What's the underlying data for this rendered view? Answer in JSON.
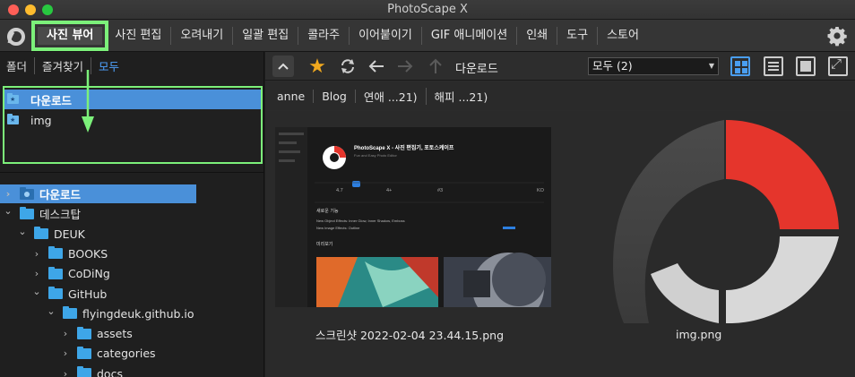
{
  "window": {
    "title": "PhotoScape X"
  },
  "menu": {
    "items": [
      "사진 뷰어",
      "사진 편집",
      "오려내기",
      "일괄 편집",
      "콜라주",
      "이어붙이기",
      "GIF 애니메이션",
      "인쇄",
      "도구",
      "스토어"
    ],
    "active": "사진 뷰어"
  },
  "left_tabs": [
    "폴더",
    "즐겨찾기",
    "모두"
  ],
  "favorites": [
    {
      "label": "다운로드",
      "selected": true
    },
    {
      "label": "img",
      "selected": false
    }
  ],
  "tree": [
    {
      "label": "다운로드",
      "level": 0,
      "expanded": false,
      "selected": true
    },
    {
      "label": "데스크탑",
      "level": 0,
      "expanded": true,
      "selected": false
    },
    {
      "label": "DEUK",
      "level": 1,
      "expanded": true,
      "selected": false
    },
    {
      "label": "BOOKS",
      "level": 2,
      "expanded": false,
      "selected": false
    },
    {
      "label": "CoDiNg",
      "level": 2,
      "expanded": false,
      "selected": false
    },
    {
      "label": "GitHub",
      "level": 2,
      "expanded": true,
      "selected": false
    },
    {
      "label": "flyingdeuk.github.io",
      "level": 3,
      "expanded": true,
      "selected": false
    },
    {
      "label": "assets",
      "level": 4,
      "expanded": false,
      "selected": false
    },
    {
      "label": "categories",
      "level": 4,
      "expanded": false,
      "selected": false
    },
    {
      "label": "docs",
      "level": 4,
      "expanded": false,
      "selected": false
    }
  ],
  "toolbar": {
    "breadcrumb": "다운로드",
    "filter_value": "모두 (2)"
  },
  "subtabs": [
    "anne",
    "Blog",
    "연애 ...21)",
    "해피 ...21)"
  ],
  "files": [
    {
      "name": "스크린샷 2022-02-04 23.44.15.png"
    },
    {
      "name": "img.png"
    }
  ],
  "thumbnail_text": {
    "app_title": "PhotoScape X - 사진 편집기, 포토스케이프",
    "app_subtitle": "Fun and Easy Photo Editor",
    "stat1": "4.7",
    "stat2": "4+",
    "stat3": "#3",
    "stat4": "KO",
    "section": "새로운 기능",
    "line1": "New Object Effects: Inner Glow, Inner Shadow, Emboss",
    "line2": "New Image Effects: Outline",
    "preview": "미리보기"
  },
  "colors": {
    "accent": "#4a90d9",
    "highlight": "#7cf07a",
    "star": "#f0a81e",
    "folder": "#3ea6e8",
    "logo_red": "#e5352c",
    "logo_gray": "#d8d8d8"
  }
}
